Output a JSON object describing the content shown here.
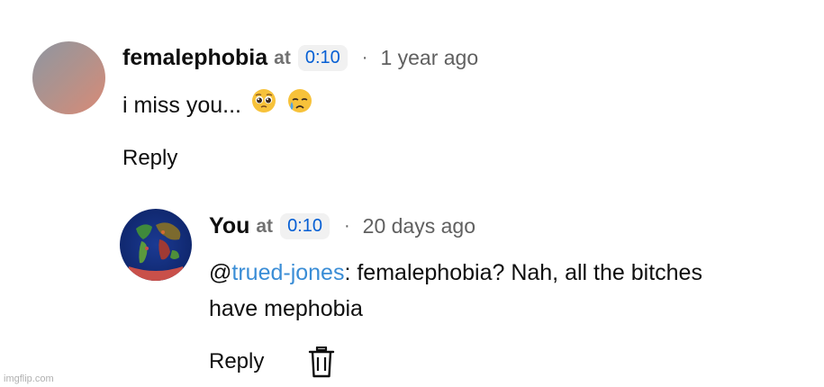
{
  "comment": {
    "author": "femalephobia",
    "at_label": "at",
    "timestamp": "0:10",
    "separator": "·",
    "age": "1 year ago",
    "text": "i miss you... ",
    "emoji_1": "pleading-face",
    "emoji_2": "crying-face",
    "reply_label": "Reply"
  },
  "reply": {
    "author": "You",
    "at_label": "at",
    "timestamp": "0:10",
    "separator": "·",
    "age": "20 days ago",
    "mention_prefix": "@",
    "mention": "trued-jones",
    "text_line1": ": femalephobia? Nah, all the bitches",
    "text_line2": "have mephobia",
    "reply_label": "Reply",
    "delete_icon": "trash-icon"
  },
  "watermark": "imgflip.com",
  "colors": {
    "timestamp_link": "#065fd4",
    "mention_link": "#3a8dd6",
    "secondary_text": "#606060"
  }
}
